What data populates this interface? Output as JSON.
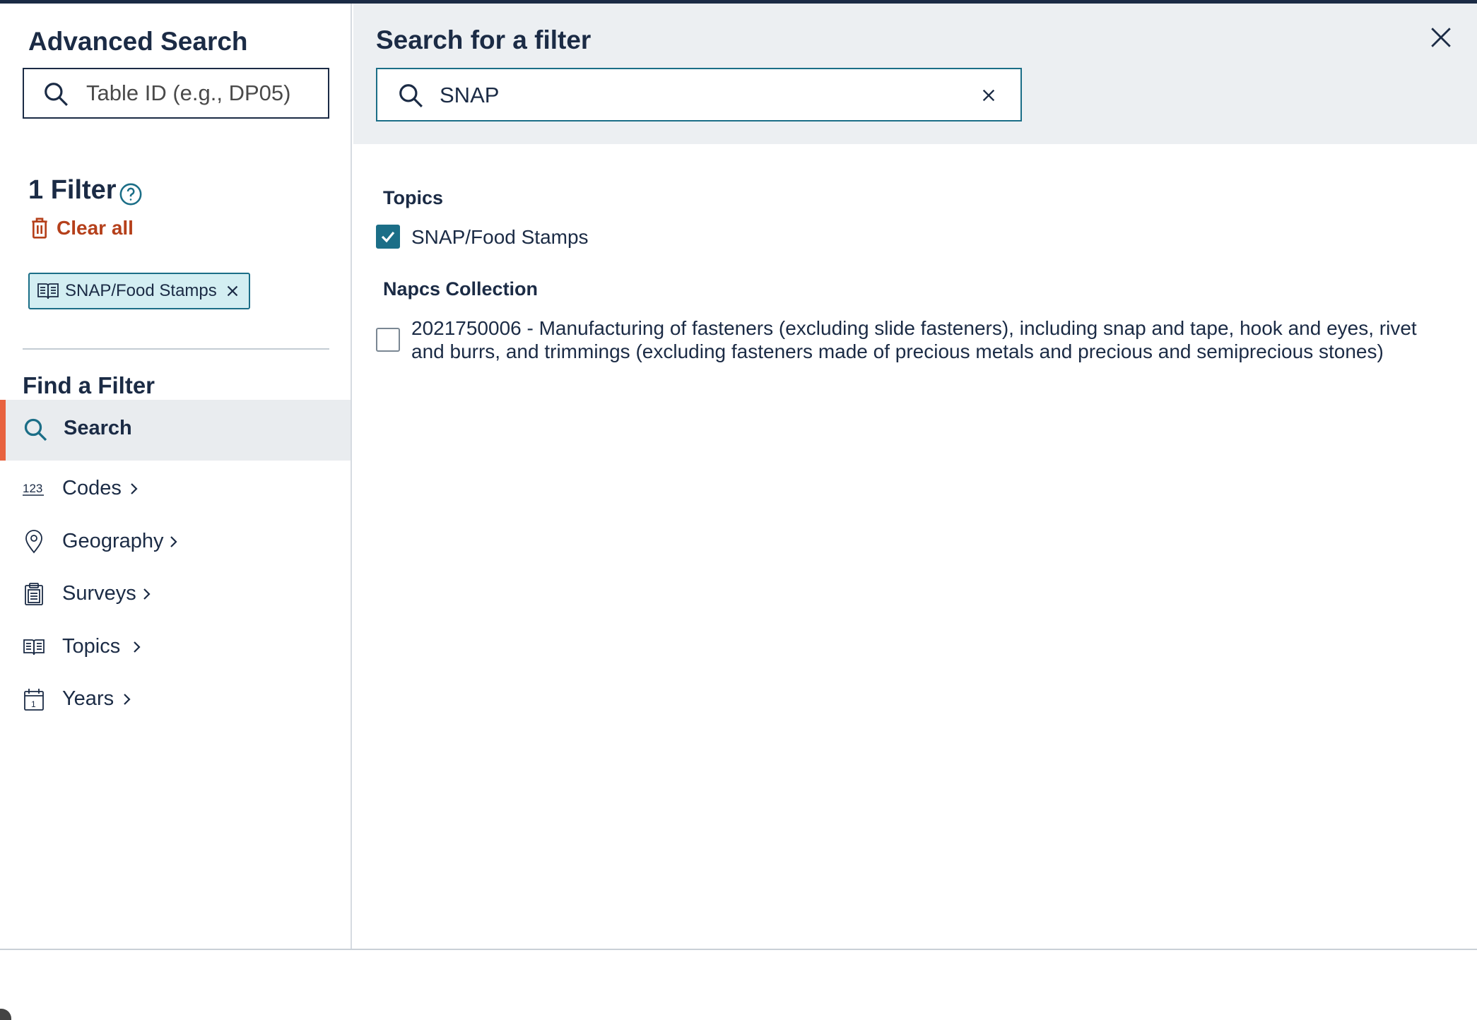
{
  "sidebar": {
    "title": "Advanced Search",
    "table_id_placeholder": "Table ID (e.g., DP05)",
    "filter_count_label": "1 Filter",
    "clear_all_label": "Clear all",
    "active_filters": [
      {
        "label": "SNAP/Food Stamps",
        "icon": "book-icon"
      }
    ],
    "find_title": "Find a Filter",
    "nav_active": {
      "label": "Search",
      "icon": "search-icon"
    },
    "nav_items": [
      {
        "label": "Codes",
        "icon": "codes-123-icon"
      },
      {
        "label": "Geography",
        "icon": "map-pin-icon"
      },
      {
        "label": "Surveys",
        "icon": "clipboard-icon"
      },
      {
        "label": "Topics",
        "icon": "book-icon"
      },
      {
        "label": "Years",
        "icon": "calendar-icon"
      }
    ]
  },
  "main": {
    "title": "Search for a filter",
    "search_value": "SNAP",
    "sections": [
      {
        "heading": "Topics",
        "options": [
          {
            "label": "SNAP/Food Stamps",
            "checked": true
          }
        ]
      },
      {
        "heading": "Napcs Collection",
        "options": [
          {
            "label_line1": "2021750006 - Manufacturing of fasteners (excluding slide fasteners), including snap and tape, hook and eyes, rivet",
            "label_line2": "and burrs, and trimmings (excluding fasteners made of precious metals and precious and semiprecious stones)",
            "checked": false
          }
        ]
      }
    ]
  },
  "colors": {
    "navy": "#1b2b45",
    "teal": "#1b6e87",
    "accent_orange": "#e8623f",
    "clear_red": "#b5401b",
    "chip_bg": "#d3eef2",
    "header_bg": "#eceff2"
  }
}
